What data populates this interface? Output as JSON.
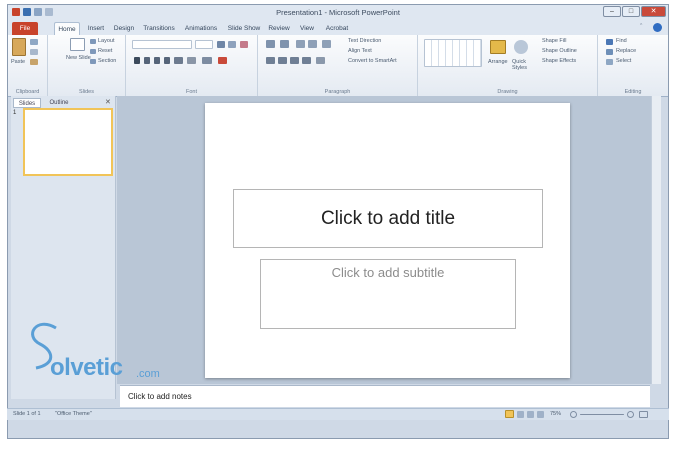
{
  "window": {
    "title": "Presentation1 - Microsoft PowerPoint"
  },
  "tabs": [
    "File",
    "Home",
    "Insert",
    "Design",
    "Transitions",
    "Animations",
    "Slide Show",
    "Review",
    "View",
    "Acrobat"
  ],
  "ribbon": {
    "clipboard": {
      "label": "Clipboard",
      "paste": "Paste"
    },
    "slides": {
      "label": "Slides",
      "new_slide": "New Slide",
      "layout": "Layout",
      "reset": "Reset",
      "section": "Section"
    },
    "font": {
      "label": "Font"
    },
    "paragraph": {
      "label": "Paragraph",
      "text_direction": "Text Direction",
      "align_text": "Align Text",
      "convert": "Convert to SmartArt"
    },
    "drawing": {
      "label": "Drawing",
      "arrange": "Arrange",
      "quick_styles": "Quick Styles",
      "shape_fill": "Shape Fill",
      "shape_outline": "Shape Outline",
      "shape_effects": "Shape Effects"
    },
    "editing": {
      "label": "Editing",
      "find": "Find",
      "replace": "Replace",
      "select": "Select"
    }
  },
  "left_pane": {
    "tabs": [
      "Slides",
      "Outline"
    ],
    "slide_number": "1"
  },
  "slide": {
    "title_placeholder": "Click to add title",
    "subtitle_placeholder": "Click to add subtitle"
  },
  "notes": {
    "placeholder": "Click to add notes"
  },
  "status": {
    "slide_info": "Slide 1 of 1",
    "theme": "\"Office Theme\"",
    "zoom": "75%"
  },
  "watermark": {
    "brand": "olvetic",
    "suffix": ".com"
  }
}
